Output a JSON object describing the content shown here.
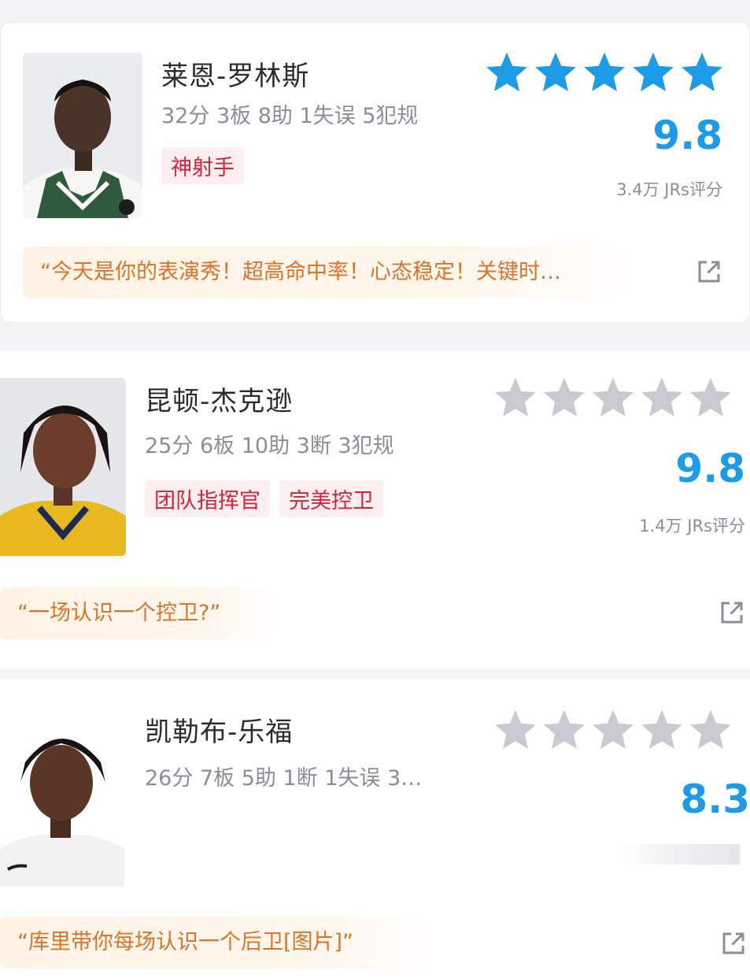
{
  "players": [
    {
      "name": "莱恩-罗林斯",
      "stats": "32分 3板 8助 1失误 5犯规",
      "tags": [
        "神射手"
      ],
      "score": "9.8",
      "raters": "3.4万 JRs评分",
      "quote": "“今天是你的表演秀！超高命中率！心态稳定！关键时…",
      "stars_filled": 5,
      "jersey": "bucks"
    },
    {
      "name": "昆顿-杰克逊",
      "stats": "25分 6板 10助 3断 3犯规",
      "tags": [
        "团队指挥官",
        "完美控卫"
      ],
      "score": "9.8",
      "raters": "1.4万 JRs评分",
      "quote": "“一场认识一个控卫?”",
      "stars_filled": 0,
      "jersey": "pacers"
    },
    {
      "name": "凯勒布-乐福",
      "stats": "26分 7板 5助 1断 1失误 3…",
      "tags": [],
      "score": "8.3",
      "raters": "",
      "quote": "“库里带你每场认识一个后卫[图片]”",
      "stars_filled": 0,
      "jersey": "white"
    }
  ],
  "colors": {
    "star_filled": "#1e9be7",
    "star_empty": "#c8cad2",
    "score": "#1e9be7",
    "tag_text": "#d3243b",
    "quote_text": "#d9742a"
  },
  "icons": {
    "share": "share-external-icon",
    "star": "star-icon"
  }
}
